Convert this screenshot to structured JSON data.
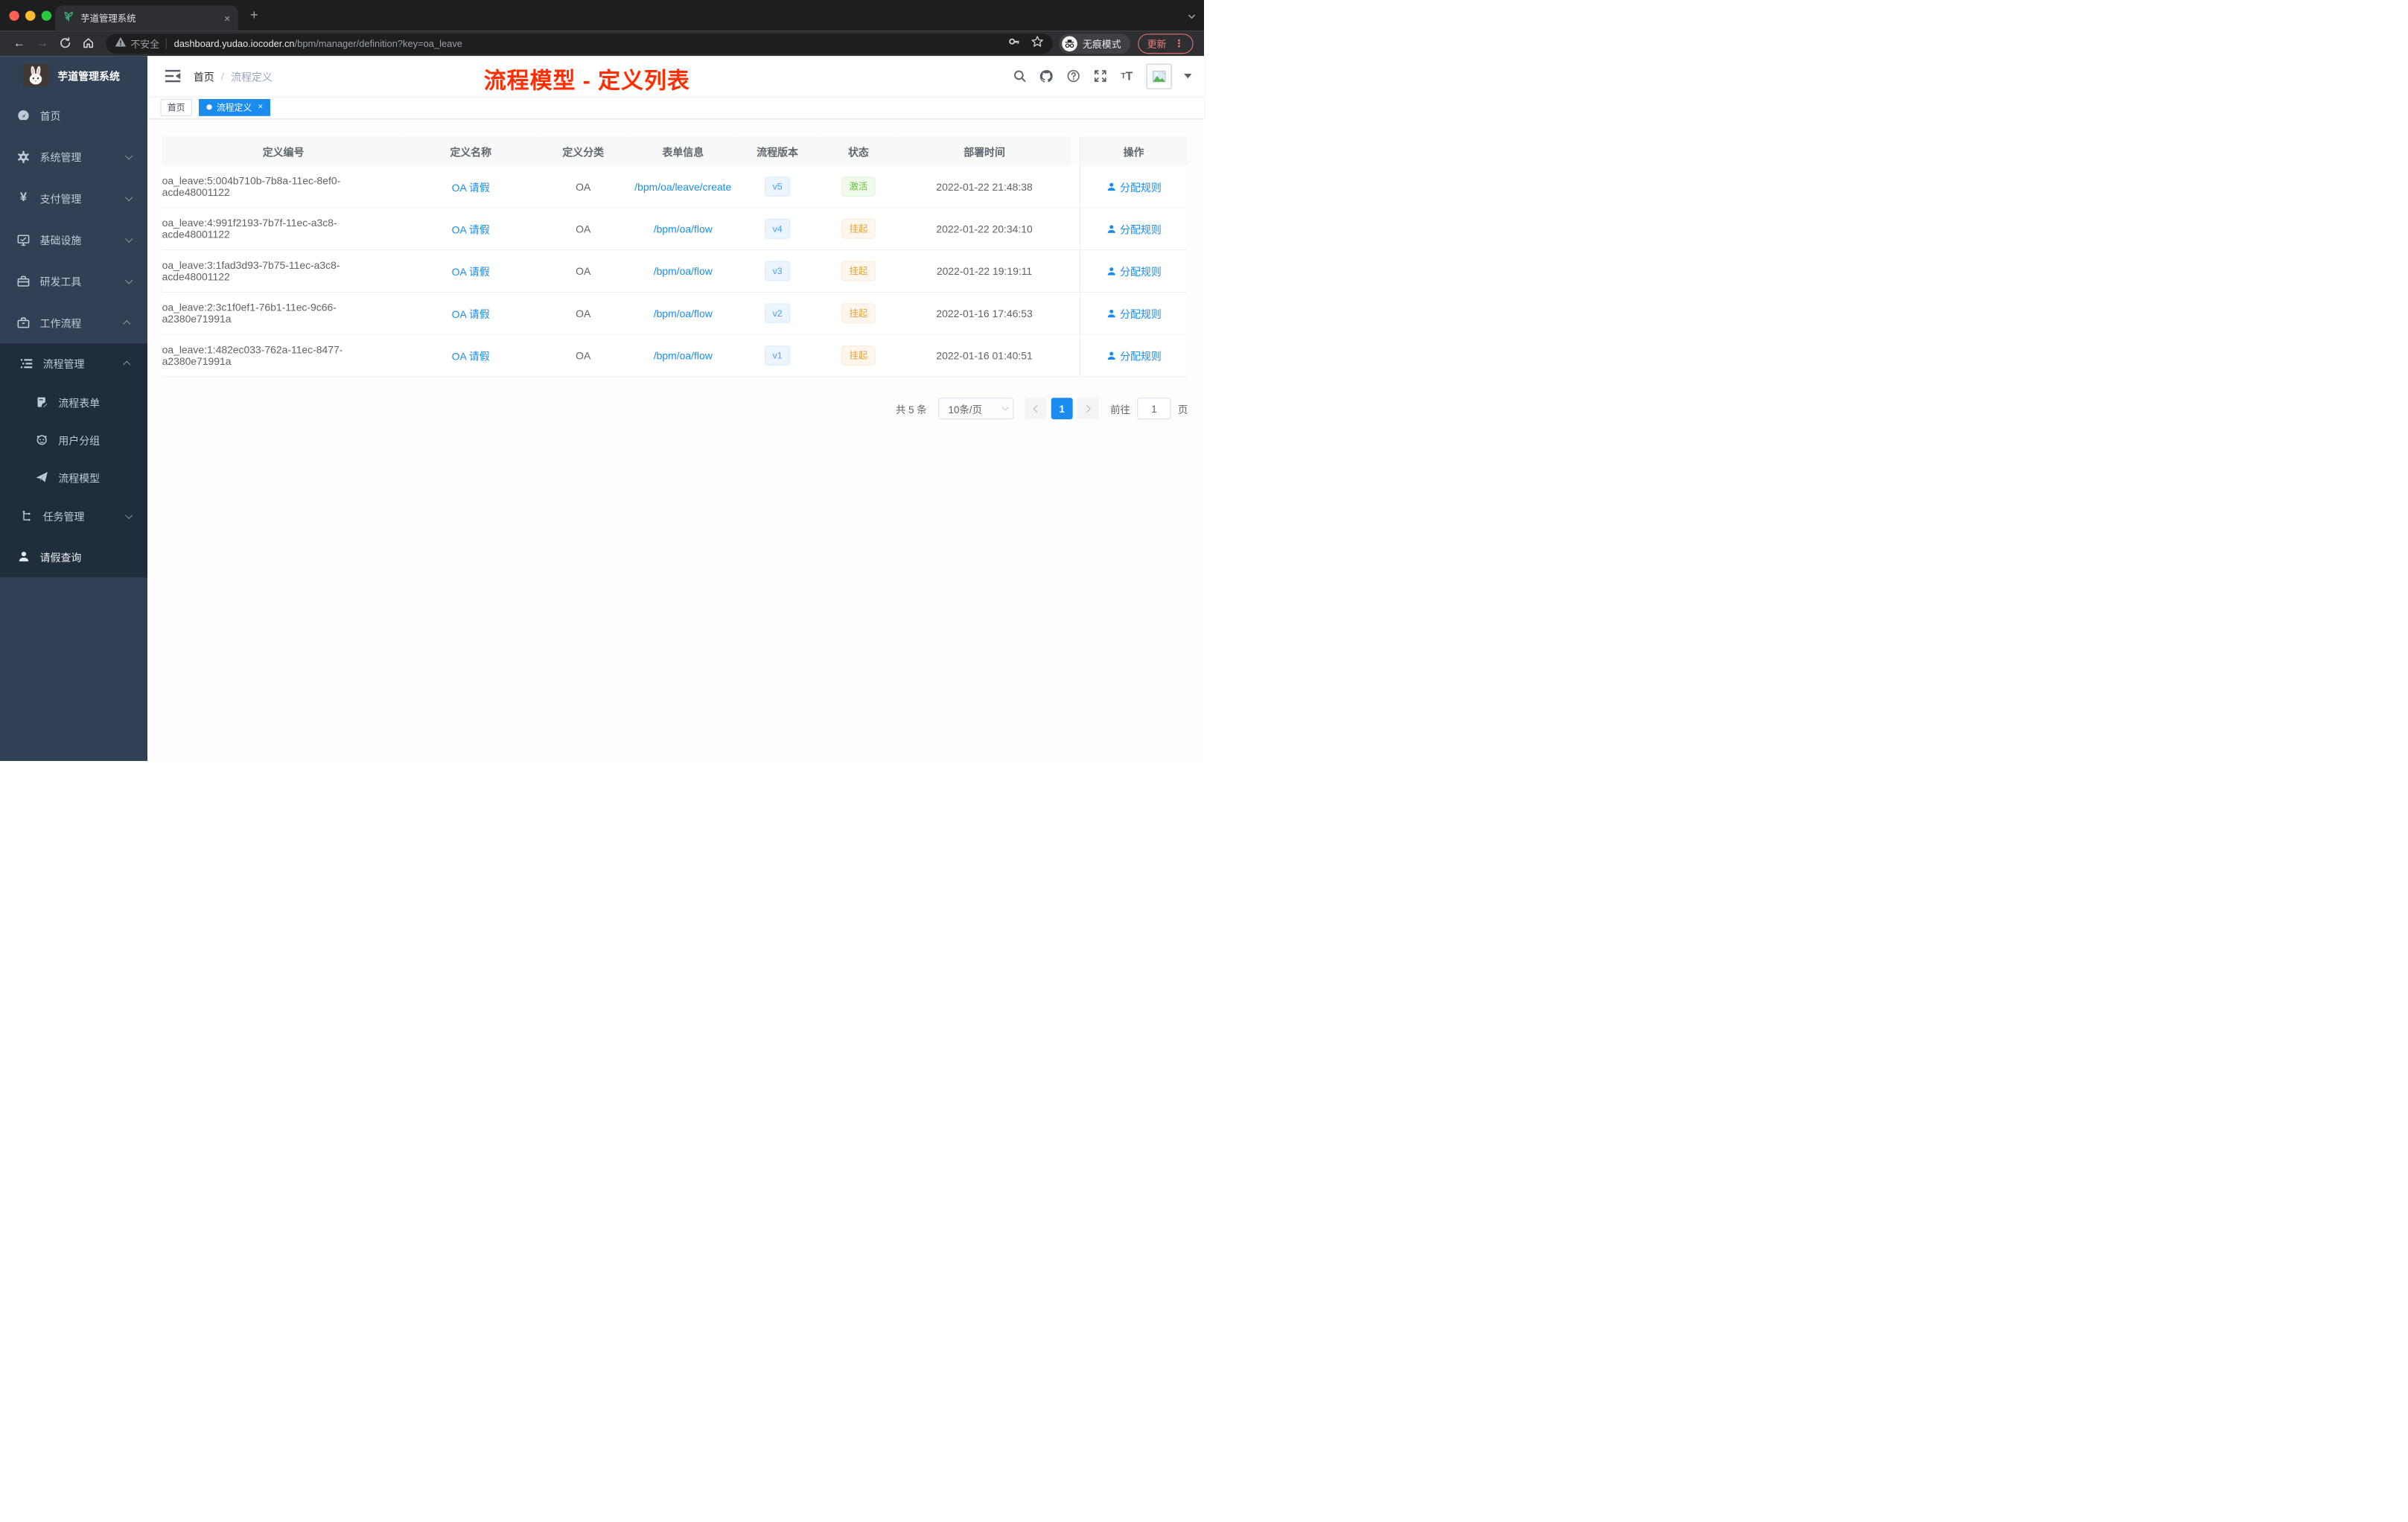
{
  "colors": {
    "accent": "#1a8cf0",
    "success": "#67c23a",
    "warning": "#e6a23c",
    "annotation_red": "#ff2d00"
  },
  "browser": {
    "tab_title": "芋道管理系统",
    "tab_close": "×",
    "new_tab": "+",
    "security_label": "不安全",
    "url_host": "dashboard.yudao.iocoder.cn",
    "url_path": "/bpm/manager/definition?key=oa_leave",
    "incognito_label": "无痕模式",
    "update_label": "更新",
    "menu_dots": "⋮"
  },
  "sidebar": {
    "app_title": "芋道管理系统",
    "items": [
      {
        "label": "首页"
      },
      {
        "label": "系统管理"
      },
      {
        "label": "支付管理"
      },
      {
        "label": "基础设施"
      },
      {
        "label": "研发工具"
      },
      {
        "label": "工作流程"
      },
      {
        "label": "流程管理"
      },
      {
        "label": "流程表单"
      },
      {
        "label": "用户分组"
      },
      {
        "label": "流程模型"
      },
      {
        "label": "任务管理"
      },
      {
        "label": "请假查询"
      }
    ],
    "yen_glyph": "¥"
  },
  "navbar": {
    "breadcrumb": [
      "首页",
      "流程定义"
    ],
    "breadcrumb_sep": "/",
    "annotation": "流程模型 - 定义列表"
  },
  "tags": {
    "home": "首页",
    "active": "流程定义",
    "close": "×"
  },
  "table": {
    "columns": [
      "定义编号",
      "定义名称",
      "定义分类",
      "表单信息",
      "流程版本",
      "状态",
      "部署时间",
      "操作"
    ],
    "rows": [
      {
        "id": "oa_leave:5:004b710b-7b8a-11ec-8ef0-acde48001122",
        "name": "OA 请假",
        "category": "OA",
        "form": "/bpm/oa/leave/create",
        "version": "v5",
        "status": "激活",
        "deploy_time": "2022-01-22 21:48:38",
        "action": "分配规则"
      },
      {
        "id": "oa_leave:4:991f2193-7b7f-11ec-a3c8-acde48001122",
        "name": "OA 请假",
        "category": "OA",
        "form": "/bpm/oa/flow",
        "version": "v4",
        "status": "挂起",
        "deploy_time": "2022-01-22 20:34:10",
        "action": "分配规则"
      },
      {
        "id": "oa_leave:3:1fad3d93-7b75-11ec-a3c8-acde48001122",
        "name": "OA 请假",
        "category": "OA",
        "form": "/bpm/oa/flow",
        "version": "v3",
        "status": "挂起",
        "deploy_time": "2022-01-22 19:19:11",
        "action": "分配规则"
      },
      {
        "id": "oa_leave:2:3c1f0ef1-76b1-11ec-9c66-a2380e71991a",
        "name": "OA 请假",
        "category": "OA",
        "form": "/bpm/oa/flow",
        "version": "v2",
        "status": "挂起",
        "deploy_time": "2022-01-16 17:46:53",
        "action": "分配规则"
      },
      {
        "id": "oa_leave:1:482ec033-762a-11ec-8477-a2380e71991a",
        "name": "OA 请假",
        "category": "OA",
        "form": "/bpm/oa/flow",
        "version": "v1",
        "status": "挂起",
        "deploy_time": "2022-01-16 01:40:51",
        "action": "分配规则"
      }
    ]
  },
  "pagination": {
    "total": "共 5 条",
    "page_size": "10条/页",
    "current_page": "1",
    "goto_label": "前往",
    "goto_value": "1",
    "unit_label": "页"
  }
}
